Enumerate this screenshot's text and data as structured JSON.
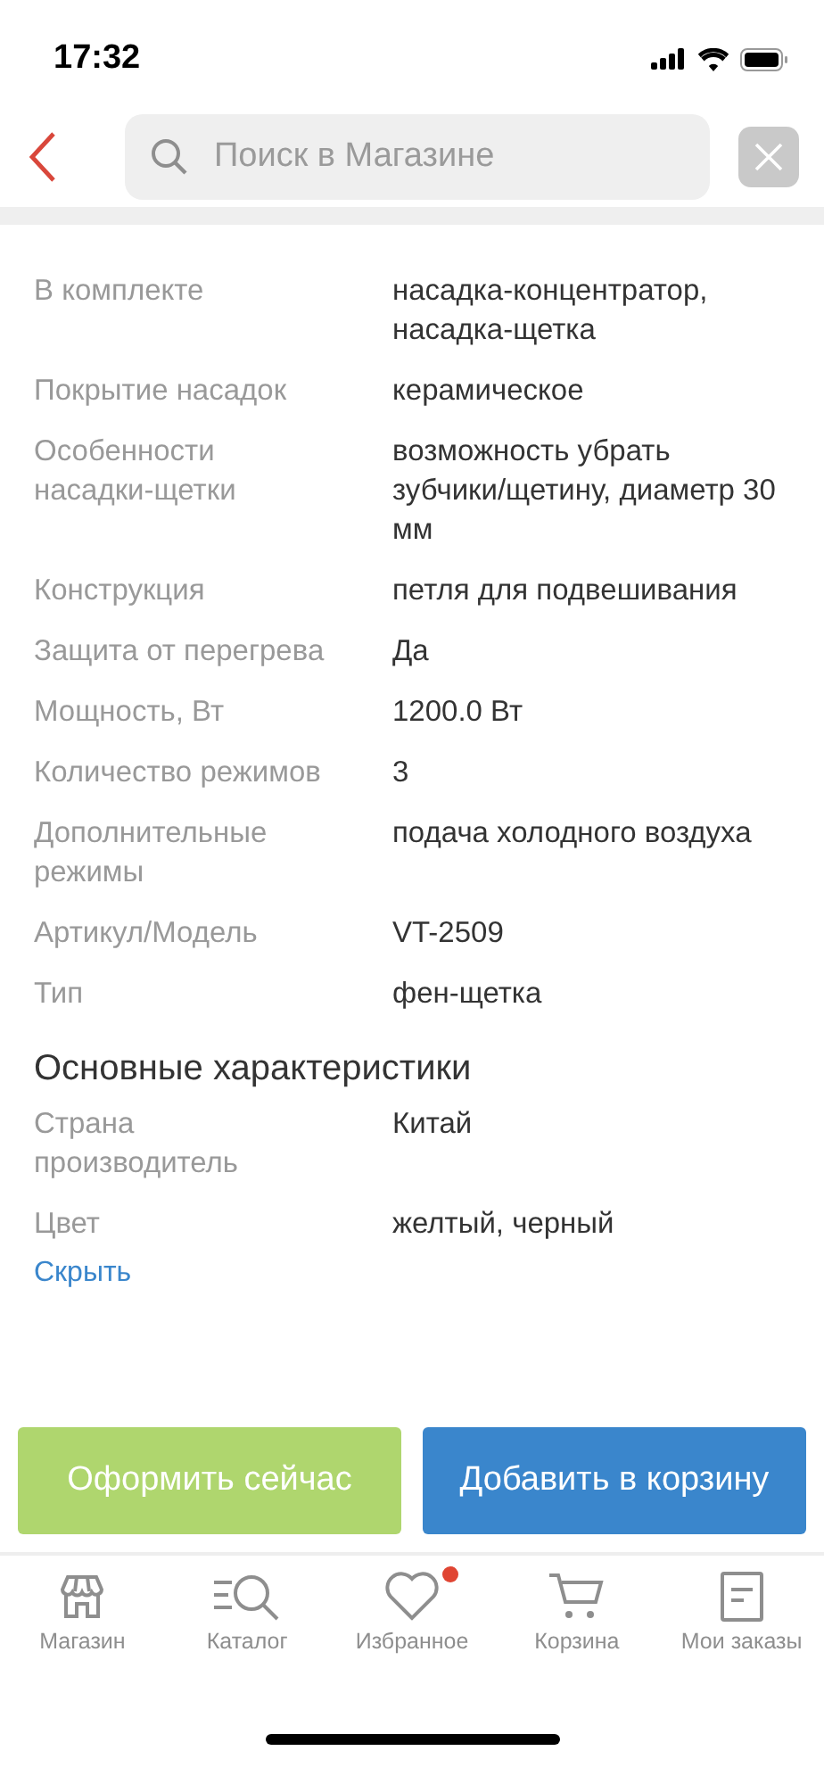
{
  "status_bar": {
    "time": "17:32"
  },
  "search": {
    "placeholder": "Поиск в Магазине"
  },
  "specs": [
    {
      "label": "В комплекте",
      "value": "насадка-концентратор, насадка-щетка"
    },
    {
      "label": "Покрытие насадок",
      "value": "керамическое"
    },
    {
      "label": "Особенности насадки-щетки",
      "value": "возможность убрать зубчики/щетину, диаметр 30 мм"
    },
    {
      "label": "Конструкция",
      "value": "петля для подвешивания"
    },
    {
      "label": "Защита от перегрева",
      "value": "Да"
    },
    {
      "label": "Мощность, Вт",
      "value": "1200.0 Вт"
    },
    {
      "label": "Количество режимов",
      "value": "3"
    },
    {
      "label": "Дополнительные режимы",
      "value": "подача холодного воздуха"
    },
    {
      "label": "Артикул/Модель",
      "value": "VT-2509"
    },
    {
      "label": "Тип",
      "value": "фен-щетка"
    }
  ],
  "main_section": {
    "title": "Основные характеристики",
    "rows": [
      {
        "label": "Страна производитель",
        "value": "Китай"
      },
      {
        "label": "Цвет",
        "value": "желтый, черный"
      }
    ],
    "hide_link": "Скрыть"
  },
  "buttons": [
    {
      "label": "Оформить сейчас",
      "kind": "buy"
    },
    {
      "label": "Добавить в корзину",
      "kind": "cart"
    }
  ],
  "nav": [
    {
      "label": "Магазин",
      "badge": false
    },
    {
      "label": "Каталог",
      "badge": false
    },
    {
      "label": "Избранное",
      "badge": true
    },
    {
      "label": "Корзина",
      "badge": false
    },
    {
      "label": "Мои заказы",
      "badge": false
    }
  ]
}
